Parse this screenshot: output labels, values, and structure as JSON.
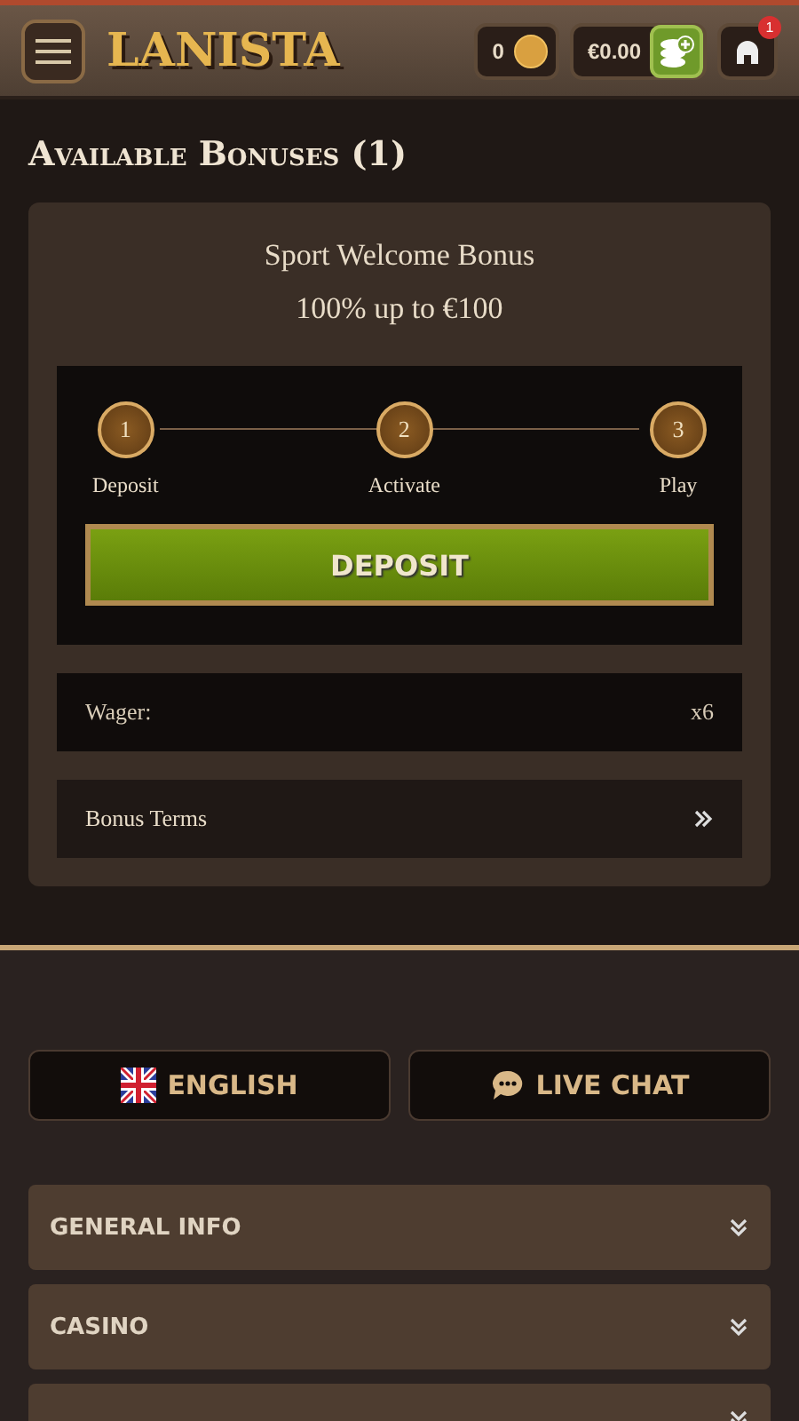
{
  "header": {
    "logo": "LANISTA",
    "coins": "0",
    "balance": "€0.00",
    "notifications": "1"
  },
  "page_title": "Available Bonuses (1)",
  "bonus": {
    "title": "Sport Welcome Bonus",
    "subtitle": "100% up to €100",
    "steps": [
      {
        "number": "1",
        "label": "Deposit"
      },
      {
        "number": "2",
        "label": "Activate"
      },
      {
        "number": "3",
        "label": "Play"
      }
    ],
    "action": "DEPOSIT",
    "wager": {
      "label": "Wager:",
      "value": "x6"
    },
    "terms": "Bonus Terms"
  },
  "footer": {
    "language": "ENGLISH",
    "chat": "LIVE CHAT",
    "sections": [
      {
        "kind": "titled",
        "label": "GENERAL INFO"
      },
      {
        "kind": "titled",
        "label": "CASINO"
      },
      {
        "kind": "clipped"
      }
    ]
  }
}
